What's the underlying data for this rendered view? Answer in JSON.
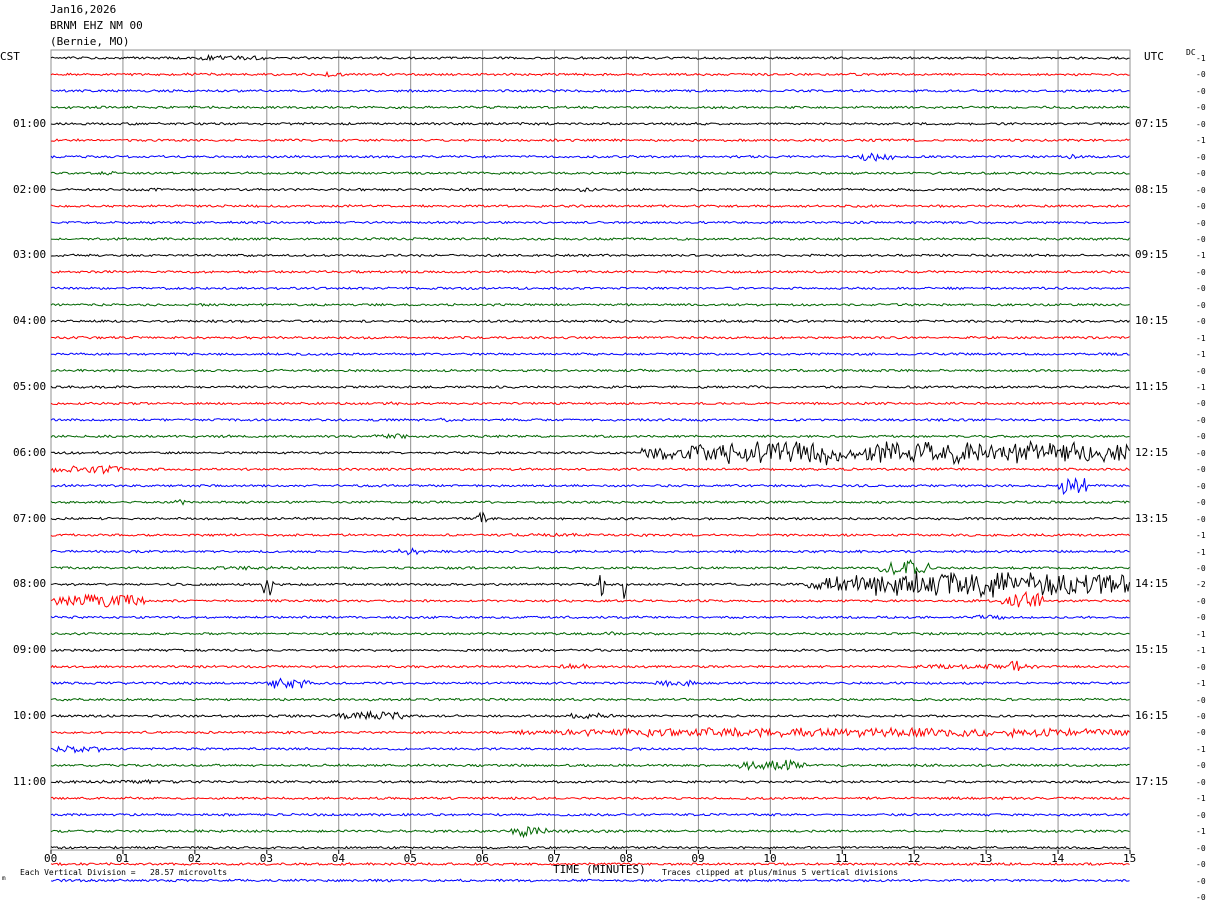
{
  "header": {
    "date": "Jan16,2026",
    "station": "BRNM EHZ NM 00",
    "location": "(Bernie, MO)"
  },
  "left_tz": "CST",
  "right_tz": "UTC",
  "dc_label": "DC",
  "footer": {
    "scale_note": "Each Vertical Division =   28.57 microvolts",
    "clip_note": "Traces clipped at plus/minus 5 vertical divisions",
    "corner_mark": "m"
  },
  "colors": {
    "black": "#000000",
    "red": "#ff0000",
    "blue": "#0000ff",
    "green": "#006600",
    "grid": "#909090"
  },
  "chart_data": {
    "type": "line",
    "title": "BRNM EHZ NM 00",
    "xlabel": "TIME (MINUTES)",
    "x_ticks": [
      "00",
      "01",
      "02",
      "03",
      "04",
      "05",
      "06",
      "07",
      "08",
      "09",
      "10",
      "11",
      "12",
      "13",
      "14",
      "15"
    ],
    "xlim": [
      0,
      15
    ],
    "traces_per_hour": 4,
    "minutes_per_trace": 15,
    "color_cycle": [
      "black",
      "red",
      "blue",
      "green"
    ],
    "left_hour_labels": [
      "01:00",
      "02:00",
      "03:00",
      "04:00",
      "05:00",
      "06:00",
      "07:00",
      "08:00",
      "09:00",
      "10:00",
      "11:00"
    ],
    "right_hour_labels": [
      "07:15",
      "08:15",
      "09:15",
      "10:15",
      "11:15",
      "12:15",
      "13:15",
      "14:15",
      "15:15",
      "16:15",
      "17:15"
    ],
    "dc_offsets": [
      "-1",
      "-0",
      "-0",
      "-0",
      "-0",
      "-1",
      "-0",
      "-0",
      "-0",
      "-0",
      "-0",
      "-0",
      "-1",
      "-0",
      "-0",
      "-0",
      "-0",
      "-1",
      "-1",
      "-0",
      "-1",
      "-0",
      "-0",
      "-0",
      "-0",
      "-0",
      "-0",
      "-0",
      "-0",
      "-1",
      "-1",
      "-0",
      "-2",
      "-0",
      "-0",
      "-1",
      "-1",
      "-0",
      "-1",
      "-0",
      "-0",
      "-0",
      "-1",
      "-0",
      "-0",
      "-1",
      "-0",
      "-1",
      "-0",
      "-0",
      "-0",
      "-0"
    ],
    "events": [
      {
        "trace": 0,
        "start": 2.0,
        "end": 3.0,
        "amp": 3
      },
      {
        "trace": 1,
        "start": 1.8,
        "end": 2.3,
        "amp": 2
      },
      {
        "trace": 1,
        "start": 3.7,
        "end": 4.1,
        "amp": 3
      },
      {
        "trace": 6,
        "start": 11.2,
        "end": 11.7,
        "amp": 5
      },
      {
        "trace": 6,
        "start": 14.1,
        "end": 14.4,
        "amp": 3
      },
      {
        "trace": 7,
        "start": 0.6,
        "end": 0.9,
        "amp": 3
      },
      {
        "trace": 8,
        "start": 1.3,
        "end": 1.6,
        "amp": 2
      },
      {
        "trace": 8,
        "start": 7.3,
        "end": 7.6,
        "amp": 3
      },
      {
        "trace": 21,
        "start": 4.5,
        "end": 5.0,
        "amp": 2
      },
      {
        "trace": 22,
        "start": 5.3,
        "end": 5.6,
        "amp": 3
      },
      {
        "trace": 23,
        "start": 4.4,
        "end": 5.0,
        "amp": 3
      },
      {
        "trace": 24,
        "start": 8.2,
        "end": 15.0,
        "amp": 13
      },
      {
        "trace": 25,
        "start": 0.0,
        "end": 1.0,
        "amp": 5
      },
      {
        "trace": 26,
        "start": 14.0,
        "end": 14.4,
        "amp": 11
      },
      {
        "trace": 27,
        "start": 1.7,
        "end": 1.9,
        "amp": 3
      },
      {
        "trace": 28,
        "start": 5.9,
        "end": 6.05,
        "amp": 8
      },
      {
        "trace": 29,
        "start": 6.3,
        "end": 7.5,
        "amp": 2
      },
      {
        "trace": 30,
        "start": 4.8,
        "end": 5.2,
        "amp": 4
      },
      {
        "trace": 31,
        "start": 2.0,
        "end": 3.5,
        "amp": 2
      },
      {
        "trace": 31,
        "start": 11.5,
        "end": 12.2,
        "amp": 9
      },
      {
        "trace": 32,
        "start": 2.9,
        "end": 3.1,
        "amp": 14
      },
      {
        "trace": 32,
        "start": 7.6,
        "end": 7.7,
        "amp": 16
      },
      {
        "trace": 32,
        "start": 7.95,
        "end": 8.0,
        "amp": 20
      },
      {
        "trace": 32,
        "start": 10.5,
        "end": 15.0,
        "amp": 14
      },
      {
        "trace": 33,
        "start": 0.0,
        "end": 1.3,
        "amp": 8
      },
      {
        "trace": 33,
        "start": 13.2,
        "end": 13.8,
        "amp": 10
      },
      {
        "trace": 34,
        "start": 12.8,
        "end": 13.3,
        "amp": 3
      },
      {
        "trace": 35,
        "start": 7.7,
        "end": 7.9,
        "amp": 3
      },
      {
        "trace": 37,
        "start": 7.0,
        "end": 7.5,
        "amp": 3
      },
      {
        "trace": 37,
        "start": 12.0,
        "end": 13.8,
        "amp": 3
      },
      {
        "trace": 37,
        "start": 13.3,
        "end": 13.5,
        "amp": 7
      },
      {
        "trace": 38,
        "start": 3.0,
        "end": 3.6,
        "amp": 7
      },
      {
        "trace": 38,
        "start": 8.4,
        "end": 9.0,
        "amp": 4
      },
      {
        "trace": 39,
        "start": 0.9,
        "end": 1.2,
        "amp": 2
      },
      {
        "trace": 40,
        "start": 3.9,
        "end": 4.9,
        "amp": 5
      },
      {
        "trace": 40,
        "start": 7.1,
        "end": 7.8,
        "amp": 3
      },
      {
        "trace": 41,
        "start": 6.5,
        "end": 15.0,
        "amp": 5
      },
      {
        "trace": 42,
        "start": 0.0,
        "end": 0.7,
        "amp": 4
      },
      {
        "trace": 43,
        "start": 9.5,
        "end": 10.5,
        "amp": 6
      },
      {
        "trace": 44,
        "start": 0.0,
        "end": 2.3,
        "amp": 2
      },
      {
        "trace": 47,
        "start": 6.4,
        "end": 6.9,
        "amp": 7
      },
      {
        "trace": 47,
        "start": 6.9,
        "end": 8.0,
        "amp": 2
      }
    ]
  }
}
